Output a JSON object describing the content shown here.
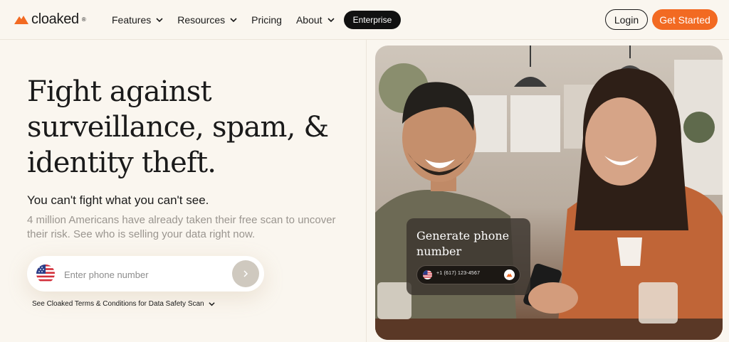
{
  "brand": {
    "name": "cloaked",
    "reg": "®",
    "accent": "#f26a22"
  },
  "nav": {
    "items": [
      {
        "label": "Features",
        "has_dropdown": true
      },
      {
        "label": "Resources",
        "has_dropdown": true
      },
      {
        "label": "Pricing",
        "has_dropdown": false
      },
      {
        "label": "About",
        "has_dropdown": true
      }
    ],
    "enterprise_label": "Enterprise",
    "login_label": "Login",
    "get_started_label": "Get Started"
  },
  "hero": {
    "headline": "Fight against surveillance, spam, & identity theft.",
    "subhead": "You can't fight what you can't see.",
    "description": "4 million Americans have already taken their free scan to uncover their risk. See who is selling your data right now.",
    "phone_placeholder": "Enter phone number",
    "submit_icon": "chevron-right-icon",
    "terms_label": "See Cloaked Terms & Conditions for Data Safety Scan"
  },
  "photo_card": {
    "title": "Generate phone number",
    "phone_value": "+1 (617) 123-4567",
    "icon": "cloaked-logo-icon"
  }
}
